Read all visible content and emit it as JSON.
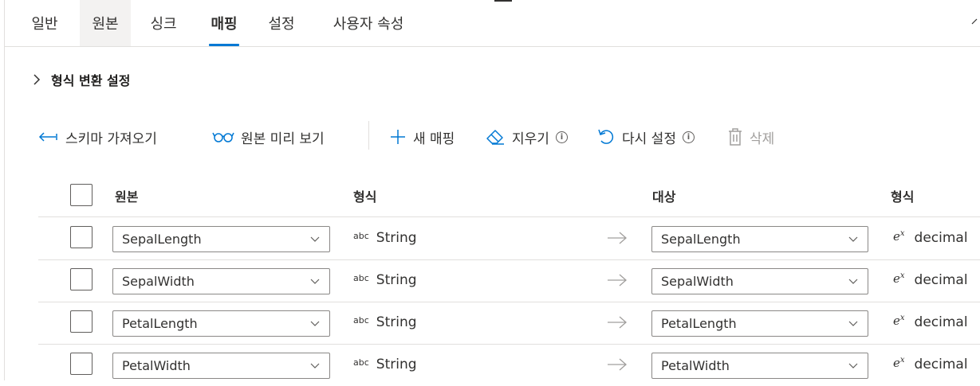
{
  "tabs": [
    {
      "label": "일반"
    },
    {
      "label": "원본"
    },
    {
      "label": "싱크"
    },
    {
      "label": "매핑"
    },
    {
      "label": "설정"
    },
    {
      "label": "사용자 속성"
    }
  ],
  "section": {
    "title": "형식 변환 설정"
  },
  "toolbar": {
    "import_schema": "스키마 가져오기",
    "preview_source": "원본 미리 보기",
    "new_mapping": "새 매핑",
    "clear": "지우기",
    "reset": "다시 설정",
    "delete": "삭제"
  },
  "table": {
    "headers": {
      "source": "원본",
      "source_type": "형식",
      "destination": "대상",
      "dest_type": "형식"
    },
    "rows": [
      {
        "source": "SepalLength",
        "source_type": "String",
        "destination": "SepalLength",
        "dest_type": "decimal"
      },
      {
        "source": "SepalWidth",
        "source_type": "String",
        "destination": "SepalWidth",
        "dest_type": "decimal"
      },
      {
        "source": "PetalLength",
        "source_type": "String",
        "destination": "PetalLength",
        "dest_type": "decimal"
      },
      {
        "source": "PetalWidth",
        "source_type": "String",
        "destination": "PetalWidth",
        "dest_type": "decimal"
      }
    ]
  },
  "type_icons": {
    "string": "abc",
    "decimal_base": "e",
    "decimal_exp": "x"
  },
  "colors": {
    "accent": "#0078d4",
    "border": "#e1dfdd",
    "disabled": "#a19f9d"
  }
}
